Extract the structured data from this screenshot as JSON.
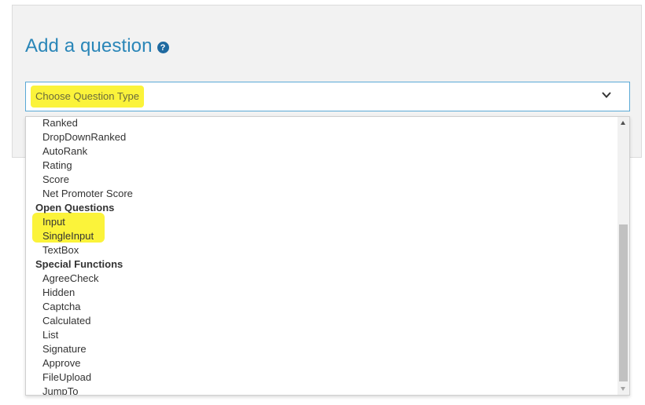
{
  "heading": {
    "title": "Add a question",
    "help_icon": "question-circle-icon",
    "help_glyph": "?"
  },
  "select": {
    "placeholder": "Choose Question Type",
    "chevron_icon": "chevron-down-icon"
  },
  "dropdown": {
    "items": [
      {
        "kind": "option",
        "label": "Ranked"
      },
      {
        "kind": "option",
        "label": "DropDownRanked"
      },
      {
        "kind": "option",
        "label": "AutoRank"
      },
      {
        "kind": "option",
        "label": "Rating"
      },
      {
        "kind": "option",
        "label": "Score"
      },
      {
        "kind": "option",
        "label": "Net Promoter Score"
      },
      {
        "kind": "group",
        "label": "Open Questions"
      },
      {
        "kind": "option",
        "label": "Input",
        "highlighted": true
      },
      {
        "kind": "option",
        "label": "SingleInput",
        "highlighted": true
      },
      {
        "kind": "option",
        "label": "TextBox"
      },
      {
        "kind": "group",
        "label": "Special Functions"
      },
      {
        "kind": "option",
        "label": "AgreeCheck"
      },
      {
        "kind": "option",
        "label": "Hidden"
      },
      {
        "kind": "option",
        "label": "Captcha"
      },
      {
        "kind": "option",
        "label": "Calculated"
      },
      {
        "kind": "option",
        "label": "List"
      },
      {
        "kind": "option",
        "label": "Signature"
      },
      {
        "kind": "option",
        "label": "Approve"
      },
      {
        "kind": "option",
        "label": "FileUpload"
      },
      {
        "kind": "option",
        "label": "JumpTo"
      }
    ]
  },
  "colors": {
    "heading": "#2a86b8",
    "highlight": "#fbf33a",
    "select_border": "#5aa9d6"
  }
}
